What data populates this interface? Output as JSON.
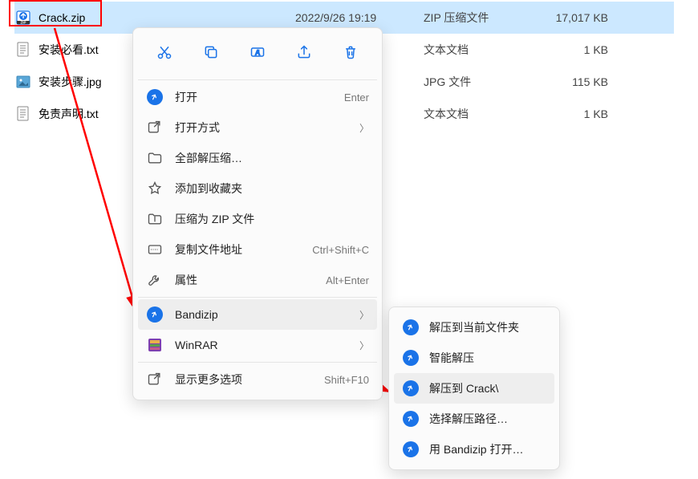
{
  "files": [
    {
      "name": "Crack.zip",
      "date": "2022/9/26 19:19",
      "type": "ZIP 压缩文件",
      "size": "17,017 KB",
      "icon": "zip",
      "selected": true
    },
    {
      "name": "安装必看.txt",
      "date": "",
      "type": "文本文档",
      "size": "1 KB",
      "icon": "txt",
      "selected": false
    },
    {
      "name": "安装步骤.jpg",
      "date": "",
      "type": "JPG 文件",
      "size": "115 KB",
      "icon": "jpg",
      "selected": false
    },
    {
      "name": "免责声明.txt",
      "date": "",
      "type": "文本文档",
      "size": "1 KB",
      "icon": "txt",
      "selected": false
    }
  ],
  "contextMenu": {
    "toolbar": [
      "cut",
      "copy",
      "rename",
      "share",
      "delete"
    ],
    "items": [
      {
        "icon": "bandizip",
        "label": "打开",
        "hint": "Enter",
        "arrow": false
      },
      {
        "icon": "openwith",
        "label": "打开方式",
        "hint": "",
        "arrow": true
      },
      {
        "icon": "folder",
        "label": "全部解压缩…",
        "hint": "",
        "arrow": false
      },
      {
        "icon": "star",
        "label": "添加到收藏夹",
        "hint": "",
        "arrow": false
      },
      {
        "icon": "zip-folder",
        "label": "压缩为 ZIP 文件",
        "hint": "",
        "arrow": false
      },
      {
        "icon": "copy-path",
        "label": "复制文件地址",
        "hint": "Ctrl+Shift+C",
        "arrow": false
      },
      {
        "icon": "wrench",
        "label": "属性",
        "hint": "Alt+Enter",
        "arrow": false
      }
    ],
    "apps": [
      {
        "icon": "bandizip",
        "label": "Bandizip",
        "arrow": true,
        "hovered": true
      },
      {
        "icon": "winrar",
        "label": "WinRAR",
        "arrow": true,
        "hovered": false
      }
    ],
    "more": {
      "icon": "more",
      "label": "显示更多选项",
      "hint": "Shift+F10"
    }
  },
  "submenu": {
    "items": [
      {
        "label": "解压到当前文件夹",
        "hovered": false
      },
      {
        "label": "智能解压",
        "hovered": false
      },
      {
        "label": "解压到 Crack\\",
        "hovered": true
      },
      {
        "label": "选择解压路径…",
        "hovered": false
      },
      {
        "label": "用 Bandizip 打开…",
        "hovered": false
      }
    ]
  }
}
